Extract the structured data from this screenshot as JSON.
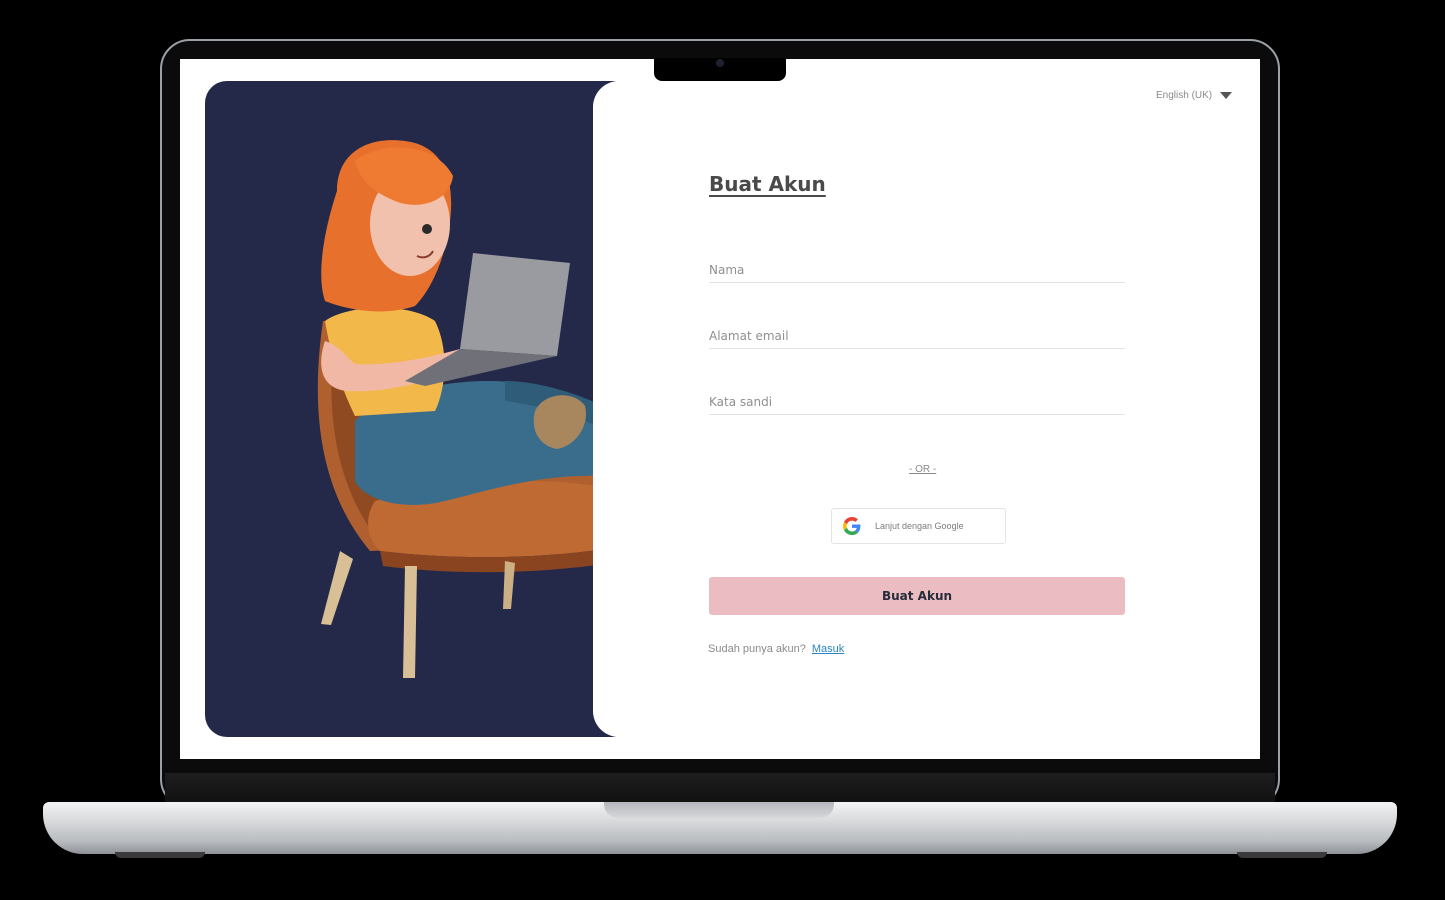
{
  "language": {
    "selected": "English (UK)",
    "icon": "caret-down-icon"
  },
  "form": {
    "title": "Buat Akun",
    "name_placeholder": "Nama",
    "email_placeholder": "Alamat email",
    "password_placeholder": "Kata sandi",
    "divider": "- OR -",
    "google_label": "Lanjut dengan Google",
    "submit_label": "Buat Akun",
    "have_account_text": "Sudah punya akun?",
    "login_link": "Masuk"
  },
  "colors": {
    "hero_bg": "#24294a",
    "submit_bg": "#ecbcc3",
    "link": "#2a86c5"
  }
}
